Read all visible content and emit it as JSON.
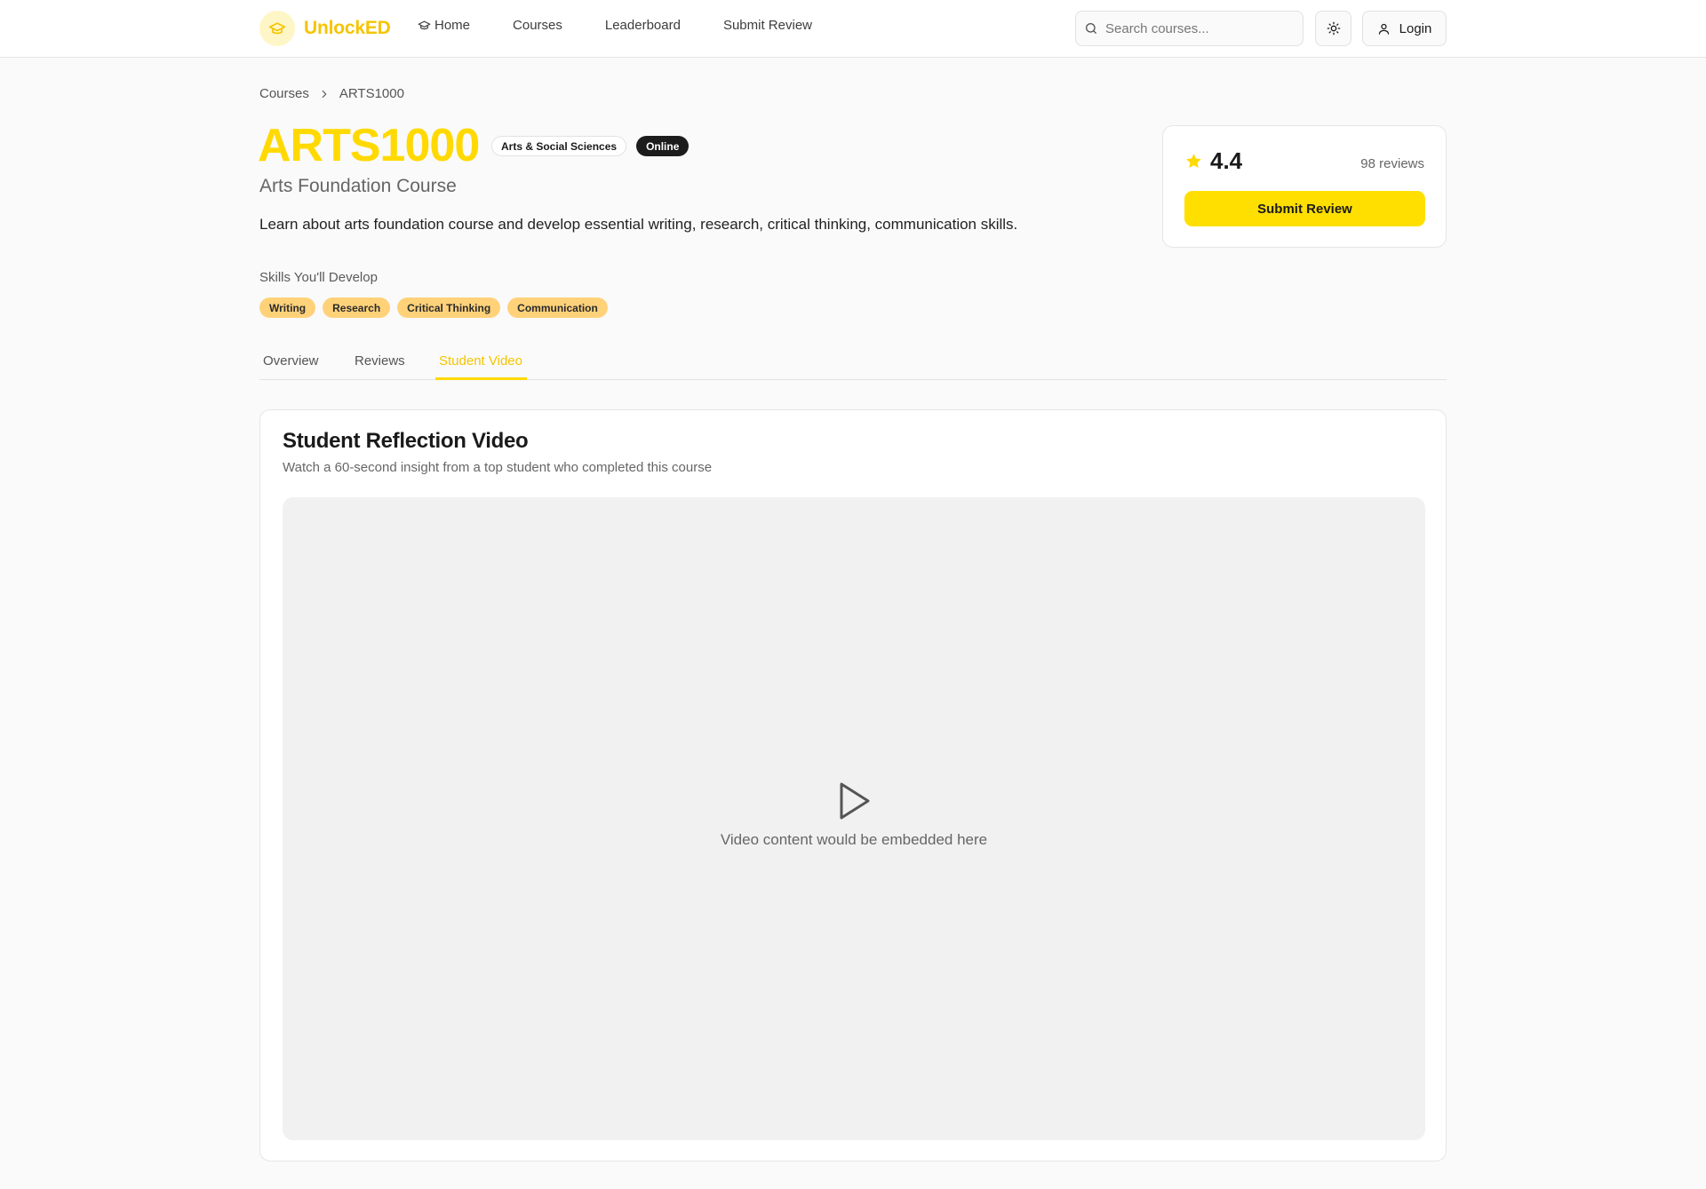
{
  "brand": {
    "name": "UnlockED",
    "accent": "#ffd900"
  },
  "nav": {
    "home": "Home",
    "courses": "Courses",
    "leaderboard": "Leaderboard",
    "submit_review": "Submit Review"
  },
  "search": {
    "placeholder": "Search courses..."
  },
  "header": {
    "login_label": "Login",
    "theme_icon": "sun-icon"
  },
  "breadcrumb": {
    "root": "Courses",
    "current": "ARTS1000"
  },
  "course": {
    "code": "ARTS1000",
    "faculty_tag": "Arts & Social Sciences",
    "mode_tag": "Online",
    "name": "Arts Foundation Course",
    "description": "Learn about arts foundation course and develop essential writing, research, critical thinking, communication skills.",
    "skills_label": "Skills You'll Develop",
    "skills": [
      "Writing",
      "Research",
      "Critical Thinking",
      "Communication"
    ]
  },
  "rating": {
    "value": "4.4",
    "review_count": "98 reviews",
    "submit_label": "Submit Review"
  },
  "tabs": [
    {
      "label": "Overview",
      "active": false
    },
    {
      "label": "Reviews",
      "active": false
    },
    {
      "label": "Student Video",
      "active": true
    }
  ],
  "video": {
    "title": "Student Reflection Video",
    "subtitle": "Watch a 60-second insight from a top student who completed this course",
    "placeholder": "Video content would be embedded here",
    "icon": "play-icon"
  }
}
